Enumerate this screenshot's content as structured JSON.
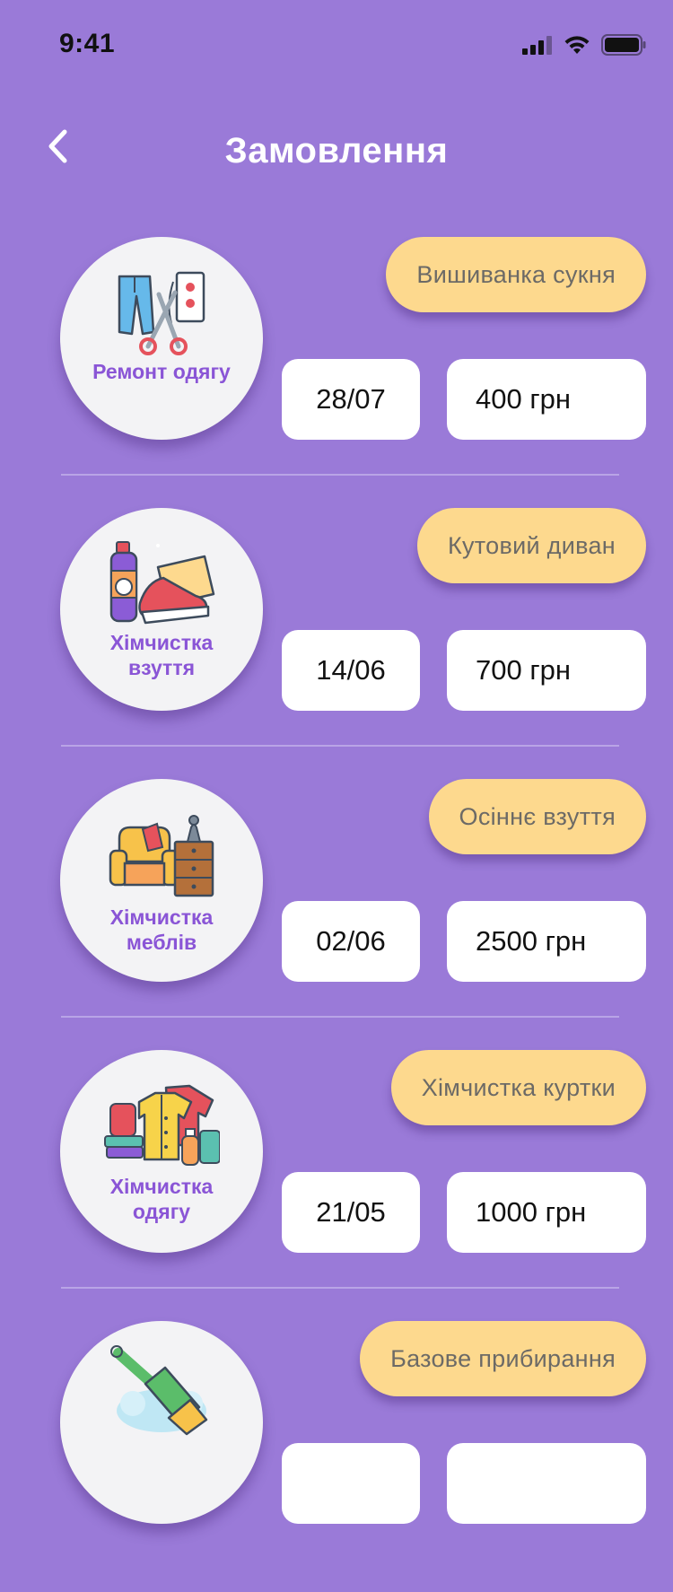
{
  "status_bar": {
    "time": "9:41"
  },
  "header": {
    "title": "Замовлення"
  },
  "colors": {
    "background": "#9a7ad8",
    "pill": "#fdd98e",
    "accent_text": "#8a55d6",
    "box": "#ffffff"
  },
  "orders": [
    {
      "service": "Ремонт одягу",
      "name": "Вишиванка сукня",
      "date": "28/07",
      "price": "400 грн",
      "icon": "clothes-repair-icon"
    },
    {
      "service": "Хімчистка взуття",
      "name": "Кутовий диван",
      "date": "14/06",
      "price": "700 грн",
      "icon": "shoe-cleaning-icon"
    },
    {
      "service": "Хімчистка меблів",
      "name": "Осіннє взуття",
      "date": "02/06",
      "price": "2500 грн",
      "icon": "furniture-cleaning-icon"
    },
    {
      "service": "Хімчистка одягу",
      "name": "Хімчистка куртки",
      "date": "21/05",
      "price": "1000 грн",
      "icon": "clothes-cleaning-icon"
    },
    {
      "service": "",
      "name": "Базове прибирання",
      "date": "",
      "price": "",
      "icon": "cleaning-brush-icon"
    }
  ]
}
